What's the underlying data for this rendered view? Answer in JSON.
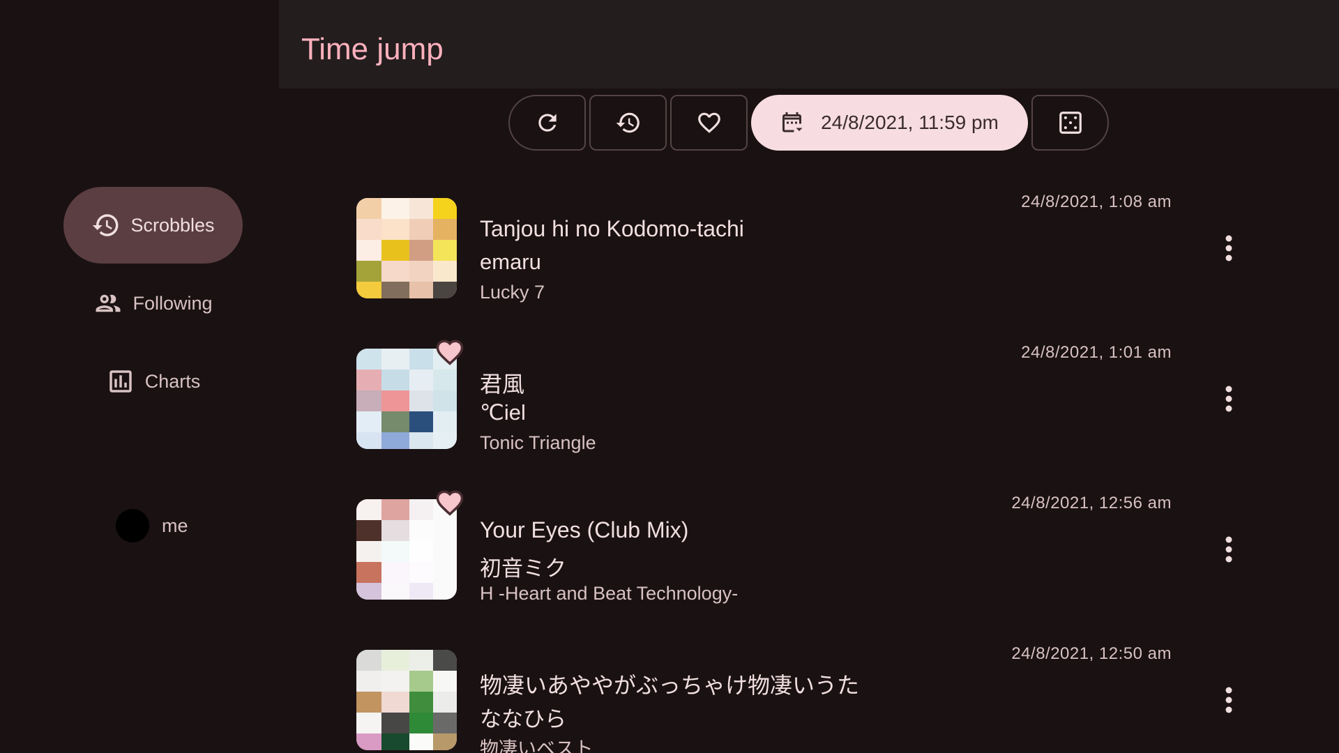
{
  "appbar": {
    "title": "Time jump"
  },
  "sidebar": {
    "items": [
      {
        "label": "Scrobbles",
        "icon": "history-icon",
        "active": true
      },
      {
        "label": "Following",
        "icon": "people-icon",
        "active": false
      },
      {
        "label": "Charts",
        "icon": "chart-icon",
        "active": false
      }
    ],
    "user": {
      "label": "me"
    }
  },
  "toolbar": {
    "buttons": [
      "refresh-icon",
      "history-icon",
      "heart-icon"
    ],
    "date_label": "24/8/2021, 11:59 pm",
    "random_icon": "dice-icon"
  },
  "colors": {
    "accent": "#ffb1bd",
    "active_nav": "#5b3e41",
    "date_chip": "#f7dde1",
    "background": "#1a1112"
  },
  "tracks": [
    {
      "title": "Tanjou hi no Kodomo-tachi",
      "artist": "emaru",
      "album": "Lucky 7",
      "time": "24/8/2021, 1:08 am",
      "loved": false
    },
    {
      "title": "君風",
      "artist": "℃iel",
      "album": "Tonic Triangle",
      "time": "24/8/2021, 1:01 am",
      "loved": true
    },
    {
      "title": "Your Eyes (Club Mix)",
      "artist": "初音ミク",
      "album": "H -Heart and Beat Technology-",
      "time": "24/8/2021, 12:56 am",
      "loved": true
    },
    {
      "title": "物凄いあややがぶっちゃけ物凄いうた",
      "artist": "ななひら",
      "album": "物凄いベスト",
      "time": "24/8/2021, 12:50 am",
      "loved": false
    }
  ]
}
